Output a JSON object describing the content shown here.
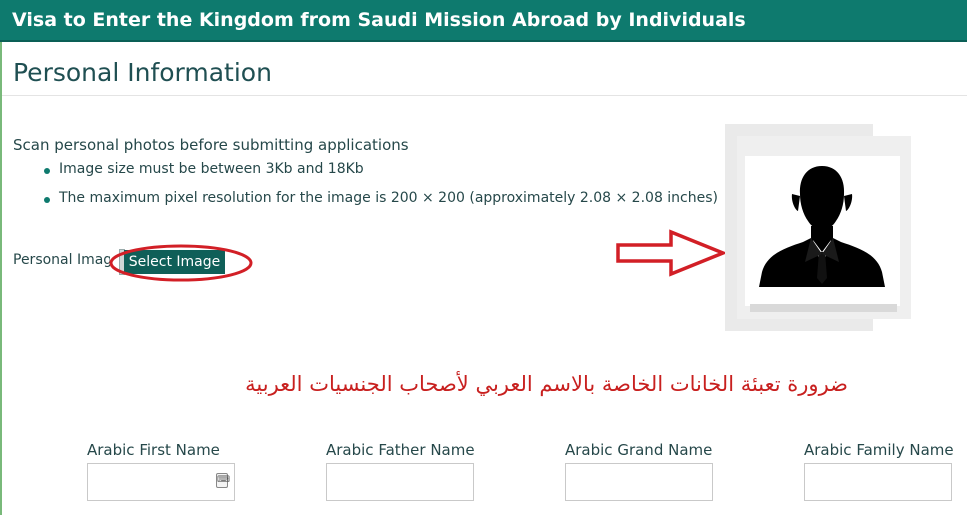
{
  "header": {
    "title": "Visa to Enter the Kingdom from Saudi Mission Abroad by Individuals"
  },
  "section": {
    "title": "Personal Information"
  },
  "scan": {
    "title": "Scan personal photos before submitting applications",
    "bullets": [
      "Image size must be between 3Kb and 18Kb",
      "The maximum pixel resolution for the image is 200 × 200 (approximately 2.08 × 2.08 inches)"
    ]
  },
  "image_upload": {
    "label": "Personal Image",
    "button_label": "Select Image"
  },
  "arabic_note": "ضرورة تعبئة الخانات الخاصة بالاسم العربي لأصحاب الجنسيات العربية",
  "fields": [
    {
      "label": "Arabic First Name",
      "value": ""
    },
    {
      "label": "Arabic Father Name",
      "value": ""
    },
    {
      "label": "Arabic Grand Name",
      "value": ""
    },
    {
      "label": "Arabic Family Name",
      "value": ""
    }
  ],
  "colors": {
    "header_bg": "#0e7a6e",
    "button_bg": "#0f5f58",
    "annotation_red": "#c8201f"
  },
  "icons": {
    "avatar_placeholder": "person-silhouette-icon",
    "annotation_arrow": "arrow-right-icon",
    "keyboard": "keyboard-icon"
  }
}
